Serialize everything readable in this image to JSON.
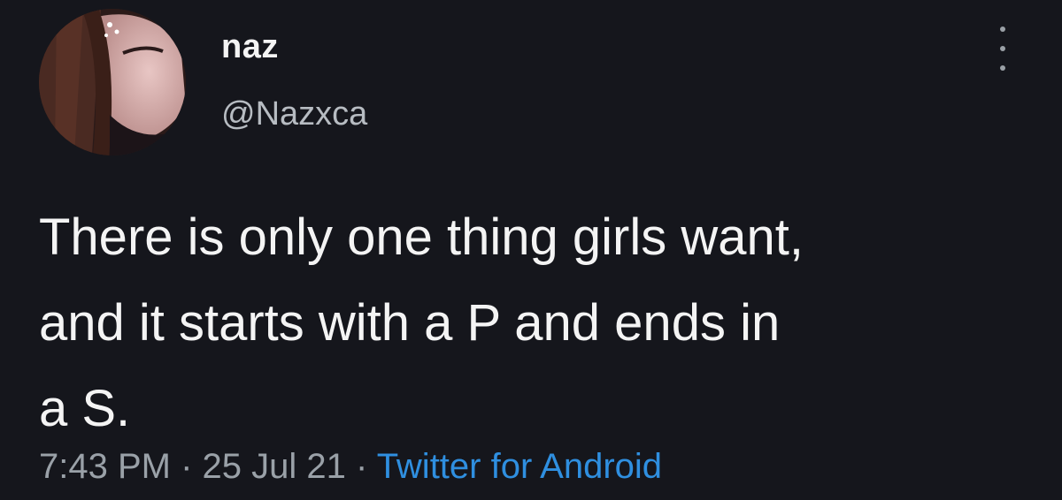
{
  "user": {
    "display_name": "naz",
    "handle": "@Nazxca",
    "avatar_icon": "profile-photo"
  },
  "menu": {
    "icon": "more-vertical-icon"
  },
  "tweet": {
    "text": "There is only one thing girls want,\nand it starts with a P and ends in\na S.",
    "time": "7:43 PM",
    "separator": " · ",
    "date": "25 Jul 21",
    "source": "Twitter for Android"
  },
  "colors": {
    "background": "#15161c",
    "text": "#f4f4f4",
    "muted": "#9aa1a8",
    "link": "#2f8fe0"
  }
}
